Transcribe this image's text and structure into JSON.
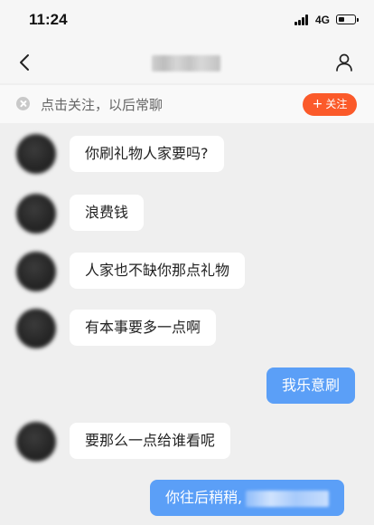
{
  "status_bar": {
    "time": "11:24",
    "network": "4G"
  },
  "follow_banner": {
    "prompt": "点击关注，以后常聊",
    "follow_label": "关注"
  },
  "messages": [
    {
      "side": "in",
      "text": "你刷礼物人家要吗?"
    },
    {
      "side": "in",
      "text": "浪费钱"
    },
    {
      "side": "in",
      "text": "人家也不缺你那点礼物"
    },
    {
      "side": "in",
      "text": "有本事要多一点啊"
    },
    {
      "side": "out",
      "text": "我乐意刷"
    },
    {
      "side": "in",
      "text": "要那么一点给谁看呢"
    },
    {
      "side": "out",
      "text": "你往后稍稍,"
    }
  ],
  "colors": {
    "accent": "#fb5a2a",
    "outgoing_bubble": "#5b9ff7",
    "incoming_bubble": "#ffffff"
  }
}
